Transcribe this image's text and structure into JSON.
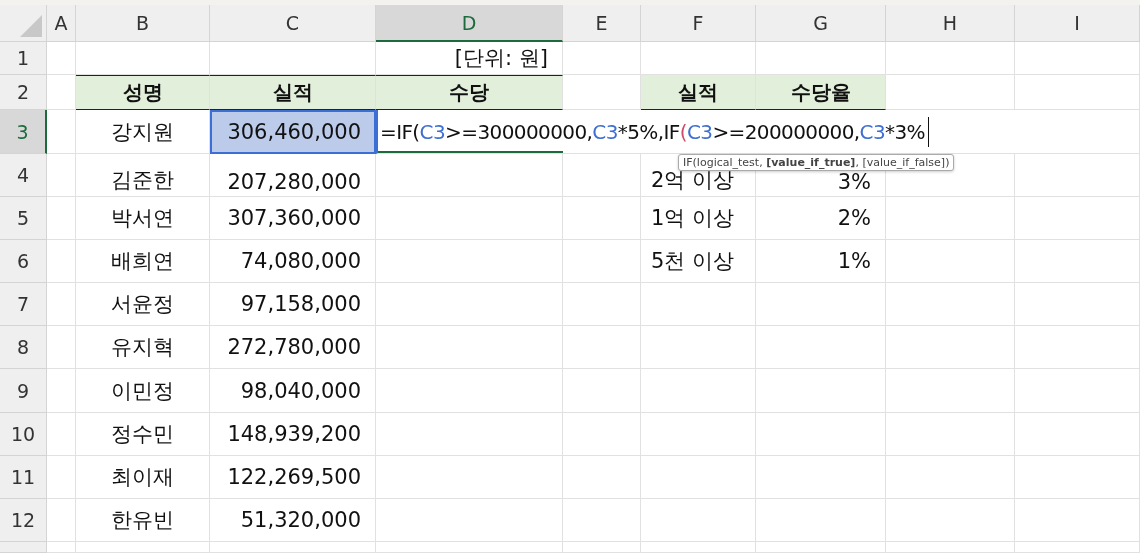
{
  "columns": [
    {
      "label": "A",
      "selected": false
    },
    {
      "label": "B",
      "selected": false
    },
    {
      "label": "C",
      "selected": false
    },
    {
      "label": "D",
      "selected": true
    },
    {
      "label": "E",
      "selected": false
    },
    {
      "label": "F",
      "selected": false
    },
    {
      "label": "G",
      "selected": false
    },
    {
      "label": "H",
      "selected": false
    },
    {
      "label": "I",
      "selected": false
    }
  ],
  "rows": [
    {
      "label": "1",
      "selected": false,
      "kind": "plain",
      "cells": {
        "D": {
          "text": "[단위: 원]",
          "selected": false
        }
      }
    },
    {
      "label": "2",
      "selected": false,
      "kind": "header",
      "cells": {
        "B": {
          "text": "성명",
          "selected": false
        },
        "C": {
          "text": "실적",
          "selected": false
        },
        "D": {
          "text": "수당",
          "selected": false
        },
        "F": {
          "text": "실적",
          "selected": false
        },
        "G": {
          "text": "수당율",
          "selected": false
        }
      }
    },
    {
      "label": "3",
      "selected": true,
      "kind": "plain",
      "cells": {
        "B": {
          "text": "강지원",
          "selected": false
        },
        "C": {
          "text": "306,460,000",
          "selected": true
        },
        "D": {
          "kind": "formula",
          "tokens": [
            {
              "text": "=IF(",
              "kind": "plain"
            },
            {
              "text": "C3",
              "kind": "ref"
            },
            {
              "text": ">=300000000,",
              "kind": "plain"
            },
            {
              "text": "C3",
              "kind": "ref"
            },
            {
              "text": "*5%,IF",
              "kind": "plain"
            },
            {
              "text": "(",
              "kind": "paren"
            },
            {
              "text": "C3",
              "kind": "ref"
            },
            {
              "text": ">=200000000,",
              "kind": "plain"
            },
            {
              "text": "C3",
              "kind": "ref"
            },
            {
              "text": "*3%",
              "kind": "plain"
            }
          ]
        }
      }
    },
    {
      "label": "4",
      "selected": false,
      "kind": "plain",
      "cells": {
        "B": {
          "text": "김준한",
          "selected": false
        },
        "C": {
          "text": "207,280,000",
          "selected": false
        },
        "F": {
          "text": "2억 이상",
          "selected": false
        },
        "G": {
          "text": "3%",
          "selected": false
        }
      }
    },
    {
      "label": "5",
      "selected": false,
      "kind": "plain",
      "cells": {
        "B": {
          "text": "박서연",
          "selected": false
        },
        "C": {
          "text": "307,360,000",
          "selected": false
        },
        "F": {
          "text": "1억 이상",
          "selected": false
        },
        "G": {
          "text": "2%",
          "selected": false
        }
      }
    },
    {
      "label": "6",
      "selected": false,
      "kind": "plain",
      "cells": {
        "B": {
          "text": "배희연",
          "selected": false
        },
        "C": {
          "text": "74,080,000",
          "selected": false
        },
        "F": {
          "text": "5천 이상",
          "selected": false
        },
        "G": {
          "text": "1%",
          "selected": false
        }
      }
    },
    {
      "label": "7",
      "selected": false,
      "kind": "plain",
      "cells": {
        "B": {
          "text": "서윤정",
          "selected": false
        },
        "C": {
          "text": "97,158,000",
          "selected": false
        }
      }
    },
    {
      "label": "8",
      "selected": false,
      "kind": "plain",
      "cells": {
        "B": {
          "text": "유지혁",
          "selected": false
        },
        "C": {
          "text": "272,780,000",
          "selected": false
        }
      }
    },
    {
      "label": "9",
      "selected": false,
      "kind": "plain",
      "cells": {
        "B": {
          "text": "이민정",
          "selected": false
        },
        "C": {
          "text": "98,040,000",
          "selected": false
        }
      }
    },
    {
      "label": "10",
      "selected": false,
      "kind": "plain",
      "cells": {
        "B": {
          "text": "정수민",
          "selected": false
        },
        "C": {
          "text": "148,939,200",
          "selected": false
        }
      }
    },
    {
      "label": "11",
      "selected": false,
      "kind": "plain",
      "cells": {
        "B": {
          "text": "최이재",
          "selected": false
        },
        "C": {
          "text": "122,269,500",
          "selected": false
        }
      }
    },
    {
      "label": "12",
      "selected": false,
      "kind": "plain",
      "cells": {
        "B": {
          "text": "한유빈",
          "selected": false
        },
        "C": {
          "text": "51,320,000",
          "selected": false
        }
      }
    }
  ],
  "tooltip": {
    "text": "IF(logical_test, **[value_if_true]**, [value_if_false])"
  }
}
